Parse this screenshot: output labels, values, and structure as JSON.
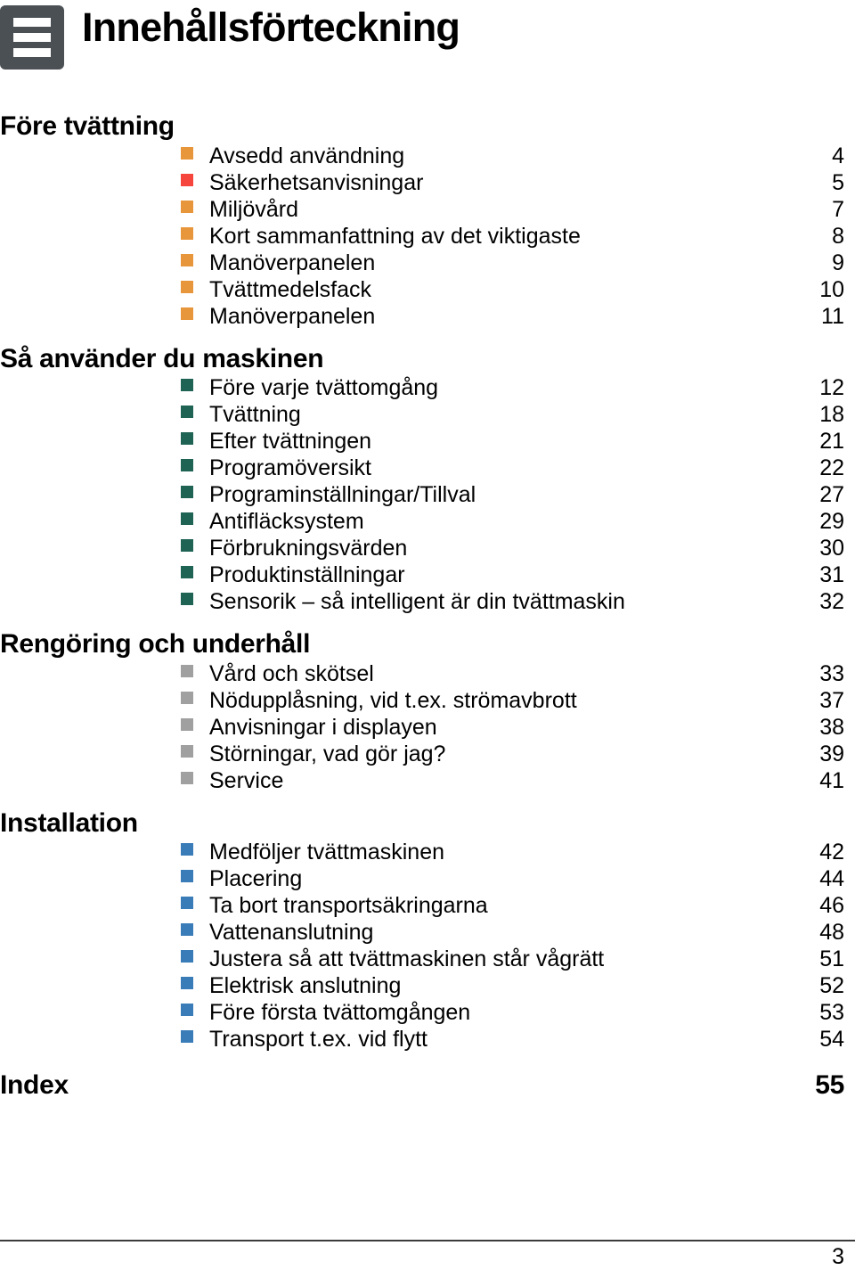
{
  "header": {
    "icon": "hamburger-menu-icon",
    "title": "Innehållsförteckning"
  },
  "colors": {
    "bullet_orange": "#E8963C",
    "bullet_red": "#F5453C",
    "bullet_teal": "#1F6355",
    "bullet_gray": "#A0A0A0",
    "bullet_blue": "#3A7CB8",
    "icon_background": "#4B5055",
    "rule": "#3B3B3B"
  },
  "sections": [
    {
      "title": "Före tvättning",
      "entries": [
        {
          "label": "Avsedd användning",
          "page": "4",
          "bullet": "orange"
        },
        {
          "label": "Säkerhetsanvisningar",
          "page": "5",
          "bullet": "red"
        },
        {
          "label": "Miljövård",
          "page": "7",
          "bullet": "orange"
        },
        {
          "label": "Kort sammanfattning av det viktigaste",
          "page": "8",
          "bullet": "orange"
        },
        {
          "label": "Manöverpanelen",
          "page": "9",
          "bullet": "orange"
        },
        {
          "label": "Tvättmedelsfack",
          "page": "10",
          "bullet": "orange"
        },
        {
          "label": "Manöverpanelen",
          "page": "11",
          "bullet": "orange"
        }
      ]
    },
    {
      "title": "Så använder du maskinen",
      "entries": [
        {
          "label": "Före varje tvättomgång",
          "page": "12",
          "bullet": "teal"
        },
        {
          "label": "Tvättning",
          "page": "18",
          "bullet": "teal"
        },
        {
          "label": "Efter tvättningen",
          "page": "21",
          "bullet": "teal"
        },
        {
          "label": "Programöversikt",
          "page": "22",
          "bullet": "teal"
        },
        {
          "label": "Programinställningar/Tillval",
          "page": "27",
          "bullet": "teal"
        },
        {
          "label": "Antifläcksystem",
          "page": "29",
          "bullet": "teal"
        },
        {
          "label": "Förbrukningsvärden",
          "page": "30",
          "bullet": "teal"
        },
        {
          "label": "Produktinställningar",
          "page": "31",
          "bullet": "teal"
        },
        {
          "label": "Sensorik – så intelligent är din tvättmaskin",
          "page": "32",
          "bullet": "teal"
        }
      ]
    },
    {
      "title": "Rengöring och underhåll",
      "entries": [
        {
          "label": "Vård och skötsel",
          "page": "33",
          "bullet": "gray"
        },
        {
          "label": "Nödupplåsning, vid t.ex. strömavbrott",
          "page": "37",
          "bullet": "gray"
        },
        {
          "label": "Anvisningar i displayen",
          "page": "38",
          "bullet": "gray"
        },
        {
          "label": "Störningar, vad gör jag?",
          "page": "39",
          "bullet": "gray"
        },
        {
          "label": "Service",
          "page": "41",
          "bullet": "gray"
        }
      ]
    },
    {
      "title": "Installation",
      "entries": [
        {
          "label": "Medföljer tvättmaskinen",
          "page": "42",
          "bullet": "blue"
        },
        {
          "label": "Placering",
          "page": "44",
          "bullet": "blue"
        },
        {
          "label": "Ta bort transportsäkringarna",
          "page": "46",
          "bullet": "blue"
        },
        {
          "label": "Vattenanslutning",
          "page": "48",
          "bullet": "blue"
        },
        {
          "label": "Justera så att tvättmaskinen står vågrätt",
          "page": "51",
          "bullet": "blue"
        },
        {
          "label": "Elektrisk anslutning",
          "page": "52",
          "bullet": "blue"
        },
        {
          "label": "Före första tvättomgången",
          "page": "53",
          "bullet": "blue"
        },
        {
          "label": "Transport t.ex. vid flytt",
          "page": "54",
          "bullet": "blue"
        }
      ]
    }
  ],
  "index": {
    "label": "Index",
    "page": "55"
  },
  "footer": {
    "page_number": "3"
  }
}
